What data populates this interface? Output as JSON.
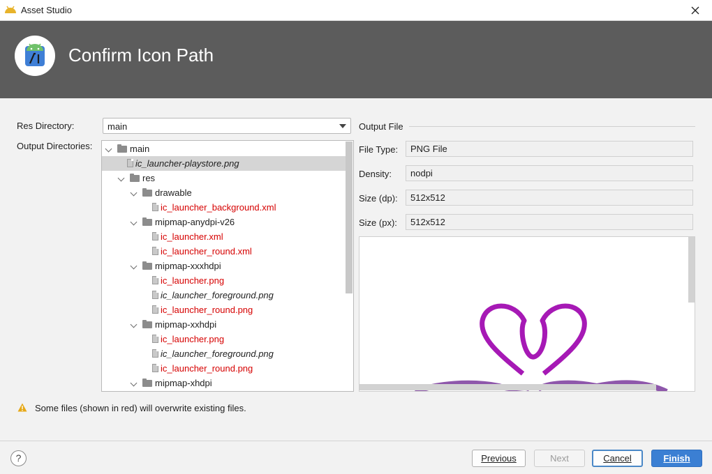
{
  "window": {
    "title": "Asset Studio"
  },
  "header": {
    "title": "Confirm Icon Path"
  },
  "form": {
    "res_directory_label": "Res Directory:",
    "res_directory_value": "main",
    "output_directories_label": "Output Directories:"
  },
  "tree": {
    "rows": [
      {
        "label": "main",
        "kind": "folder",
        "level": 0,
        "expanded": true,
        "red": false,
        "italic": false
      },
      {
        "label": "ic_launcher-playstore.png",
        "kind": "file",
        "level": 1,
        "red": false,
        "italic": true,
        "selected": true
      },
      {
        "label": "res",
        "kind": "folder",
        "level": 1,
        "expanded": true,
        "red": false,
        "italic": false
      },
      {
        "label": "drawable",
        "kind": "folder",
        "level": 2,
        "expanded": true,
        "red": false,
        "italic": false
      },
      {
        "label": "ic_launcher_background.xml",
        "kind": "file",
        "level": 3,
        "red": true,
        "italic": false
      },
      {
        "label": "mipmap-anydpi-v26",
        "kind": "folder",
        "level": 2,
        "expanded": true,
        "red": false,
        "italic": false
      },
      {
        "label": "ic_launcher.xml",
        "kind": "file",
        "level": 3,
        "red": true,
        "italic": false
      },
      {
        "label": "ic_launcher_round.xml",
        "kind": "file",
        "level": 3,
        "red": true,
        "italic": false
      },
      {
        "label": "mipmap-xxxhdpi",
        "kind": "folder",
        "level": 2,
        "expanded": true,
        "red": false,
        "italic": false
      },
      {
        "label": "ic_launcher.png",
        "kind": "file",
        "level": 3,
        "red": true,
        "italic": false
      },
      {
        "label": "ic_launcher_foreground.png",
        "kind": "file",
        "level": 3,
        "red": false,
        "italic": true
      },
      {
        "label": "ic_launcher_round.png",
        "kind": "file",
        "level": 3,
        "red": true,
        "italic": false
      },
      {
        "label": "mipmap-xxhdpi",
        "kind": "folder",
        "level": 2,
        "expanded": true,
        "red": false,
        "italic": false
      },
      {
        "label": "ic_launcher.png",
        "kind": "file",
        "level": 3,
        "red": true,
        "italic": false
      },
      {
        "label": "ic_launcher_foreground.png",
        "kind": "file",
        "level": 3,
        "red": false,
        "italic": true
      },
      {
        "label": "ic_launcher_round.png",
        "kind": "file",
        "level": 3,
        "red": true,
        "italic": false
      },
      {
        "label": "mipmap-xhdpi",
        "kind": "folder",
        "level": 2,
        "expanded": true,
        "red": false,
        "italic": false
      }
    ]
  },
  "output_file": {
    "section_label": "Output File",
    "file_type_label": "File Type:",
    "file_type_value": "PNG File",
    "density_label": "Density:",
    "density_value": "nodpi",
    "size_dp_label": "Size (dp):",
    "size_dp_value": "512x512",
    "size_px_label": "Size (px):",
    "size_px_value": "512x512"
  },
  "warning": {
    "text": "Some files (shown in red) will overwrite existing files."
  },
  "footer": {
    "help": "?",
    "previous": "Previous",
    "next": "Next",
    "cancel": "Cancel",
    "finish": "Finish"
  },
  "colors": {
    "header_bg": "#5c5c5c",
    "overwrite_red": "#d60000",
    "primary_button": "#3b7fd3",
    "preview_icon": "#a619b5"
  }
}
